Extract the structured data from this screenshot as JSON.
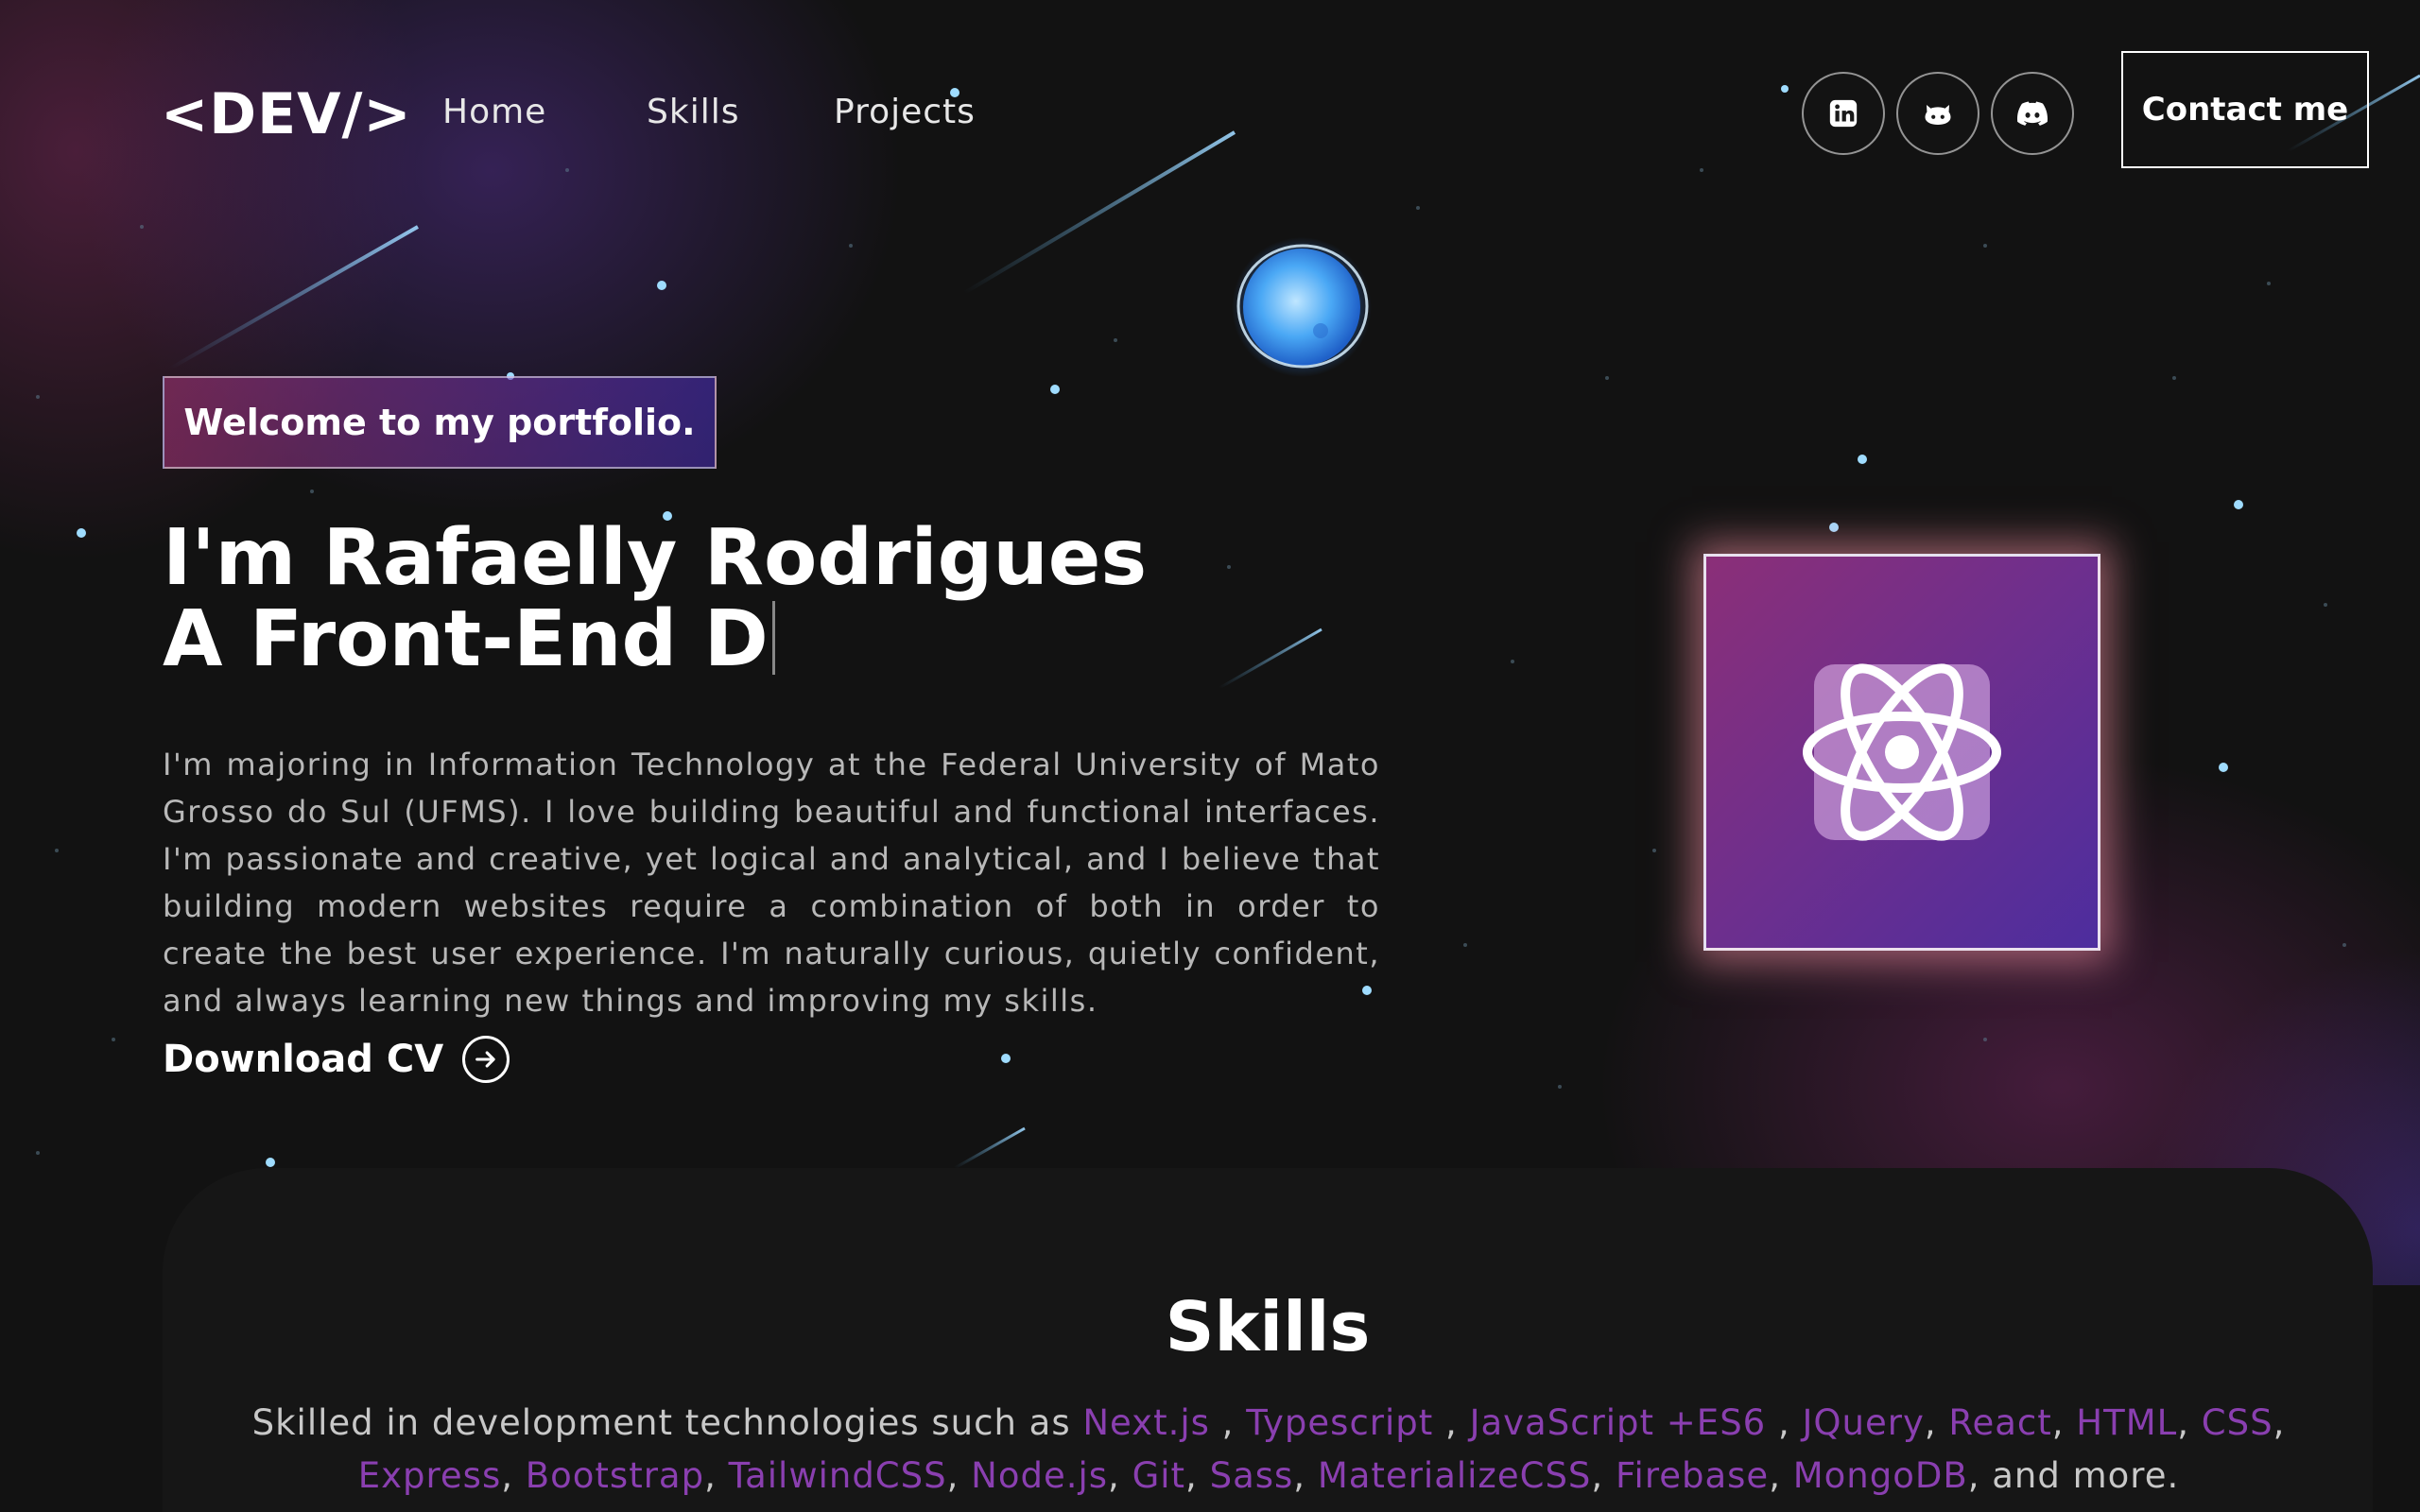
{
  "nav": {
    "logo": "<DEV/>",
    "links": [
      "Home",
      "Skills",
      "Projects"
    ],
    "social": [
      "linkedin-icon",
      "github-icon",
      "discord-icon"
    ],
    "contact_label": "Contact me"
  },
  "hero": {
    "welcome": "Welcome to my portfolio.",
    "name_line": "I'm Rafaelly Rodrigues",
    "role_line": "A Front-End D",
    "intro": "I'm majoring in Information Technology at the Federal University of Mato Grosso do Sul (UFMS). I love building beautiful and functional interfaces. I'm passionate and creative, yet logical and analytical, and I believe that building modern websites require a combination of both in order to create the best user experience. I'm naturally curious, quietly confident, and always learning new things and improving my skills.",
    "download_label": "Download CV"
  },
  "skills": {
    "title": "Skills",
    "lead": "Skilled in development technologies such as ",
    "techs": [
      "Next.js",
      "Typescript",
      "JavaScript +ES6",
      "JQuery",
      "React",
      "HTML",
      "CSS",
      "Express",
      "Bootstrap",
      "TailwindCSS",
      "Node.js",
      "Git",
      "Sass",
      "MaterializeCSS",
      "Firebase",
      "MongoDB"
    ],
    "sep_spaced": " , ",
    "sep": ", ",
    "tail": ", and more."
  },
  "colors": {
    "accent": "#8a3fb0",
    "background": "#121212"
  }
}
